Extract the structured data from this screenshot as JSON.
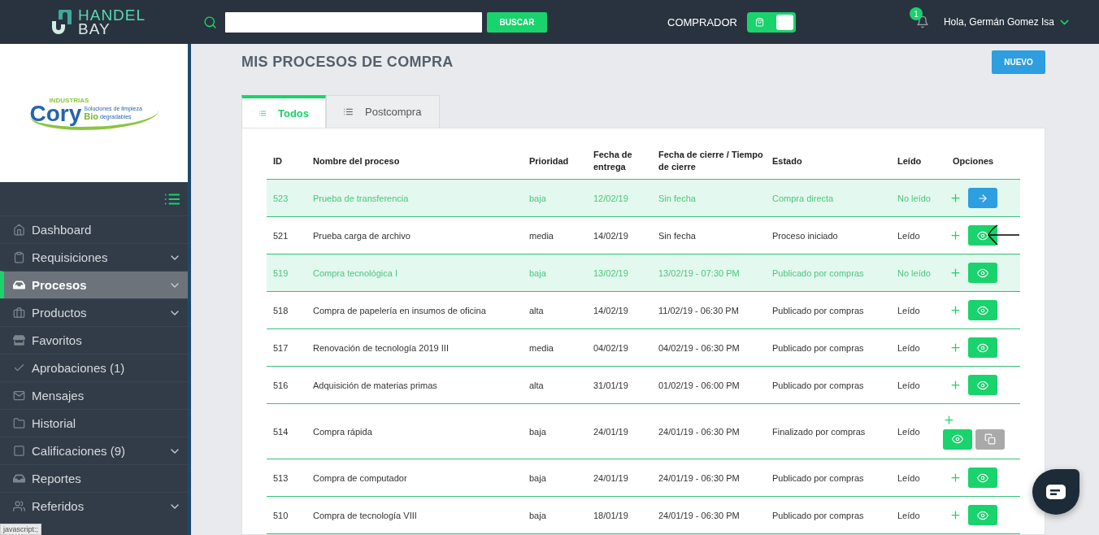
{
  "header": {
    "brand": {
      "line_1": "HANDEL",
      "line_2": "BAY"
    },
    "search": {
      "button": "BUSCAR"
    },
    "role": {
      "label": "COMPRADOR",
      "on": true
    },
    "notifications": {
      "count": "1"
    },
    "user": {
      "greeting": "Hola, Germán Gomez Isa"
    }
  },
  "company_logo": {
    "top": "INDUSTRIAS",
    "name": "Cory",
    "tagline": "Soluciones de limpieza",
    "bio": "Bio",
    "suffix": "degradables"
  },
  "sidebar": {
    "items": [
      {
        "label": "Dashboard",
        "expandable": false,
        "selected": false
      },
      {
        "label": "Requisiciones",
        "expandable": true,
        "selected": false
      },
      {
        "label": "Procesos",
        "expandable": true,
        "selected": true
      },
      {
        "label": "Productos",
        "expandable": true,
        "selected": false
      },
      {
        "label": "Favoritos",
        "expandable": false,
        "selected": false
      },
      {
        "label": "Aprobaciones (1)",
        "expandable": false,
        "selected": false
      },
      {
        "label": "Mensajes",
        "expandable": false,
        "selected": false
      },
      {
        "label": "Historial",
        "expandable": false,
        "selected": false
      },
      {
        "label": "Calificaciones (9)",
        "expandable": true,
        "selected": false
      },
      {
        "label": "Reportes",
        "expandable": false,
        "selected": false
      },
      {
        "label": "Referidos",
        "expandable": true,
        "selected": false
      }
    ]
  },
  "page": {
    "title": "MIS PROCESOS DE COMPRA",
    "new_button": "NUEVO"
  },
  "tabs": [
    {
      "label": "Todos",
      "selected": true
    },
    {
      "label": "Postcompra",
      "selected": false
    }
  ],
  "table": {
    "columns": [
      "ID",
      "Nombre del proceso",
      "Prioridad",
      "Fecha de entrega",
      "Fecha de cierre / Tiempo de cierre",
      "Estado",
      "Leído",
      "Opciones"
    ],
    "rows": [
      {
        "id": "523",
        "name": "Prueba de transferencia",
        "priority": "baja",
        "delivery": "12/02/19",
        "closing": "Sin fecha",
        "status": "Compra directa",
        "read_label": "No leído",
        "read": false,
        "kind": "arrow",
        "annotated": false
      },
      {
        "id": "521",
        "name": "Prueba carga de archivo",
        "priority": "media",
        "delivery": "14/02/19",
        "closing": "Sin fecha",
        "status": "Proceso iniciado",
        "read_label": "Leído",
        "read": true,
        "kind": "eye",
        "annotated": true
      },
      {
        "id": "519",
        "name": "Compra tecnológica I",
        "priority": "baja",
        "delivery": "13/02/19",
        "closing": "13/02/19 - 07:30 PM",
        "status": "Publicado por compras",
        "read_label": "No leído",
        "read": false,
        "kind": "eye",
        "annotated": false
      },
      {
        "id": "518",
        "name": "Compra de papelería en insumos de oficina",
        "priority": "alta",
        "delivery": "14/02/19",
        "closing": "11/02/19 - 06:30 PM",
        "status": "Publicado por compras",
        "read_label": "Leído",
        "read": true,
        "kind": "eye",
        "annotated": false
      },
      {
        "id": "517",
        "name": "Renovación de tecnología 2019 III",
        "priority": "media",
        "delivery": "04/02/19",
        "closing": "04/02/19 - 06:30 PM",
        "status": "Publicado por compras",
        "read_label": "Leído",
        "read": true,
        "kind": "eye",
        "annotated": false
      },
      {
        "id": "516",
        "name": "Adquisición de materias primas",
        "priority": "alta",
        "delivery": "31/01/19",
        "closing": "01/02/19 - 06:00 PM",
        "status": "Publicado por compras",
        "read_label": "Leído",
        "read": true,
        "kind": "eye",
        "annotated": false
      },
      {
        "id": "514",
        "name": "Compra rápida",
        "priority": "baja",
        "delivery": "24/01/19",
        "closing": "24/01/19 - 06:30 PM",
        "status": "Finalizado por compras",
        "read_label": "Leído",
        "read": true,
        "kind": "eye-copy",
        "annotated": false
      },
      {
        "id": "513",
        "name": "Compra de computador",
        "priority": "baja",
        "delivery": "24/01/19",
        "closing": "24/01/19 - 06:30 PM",
        "status": "Publicado por compras",
        "read_label": "Leído",
        "read": true,
        "kind": "eye",
        "annotated": false
      },
      {
        "id": "510",
        "name": "Compra de tecnología VIII",
        "priority": "baja",
        "delivery": "18/01/19",
        "closing": "24/01/19 - 06:30 PM",
        "status": "Publicado por compras",
        "read_label": "Leído",
        "read": true,
        "kind": "eye",
        "annotated": false
      }
    ]
  },
  "status_bar": {
    "text": "javascript:;"
  }
}
